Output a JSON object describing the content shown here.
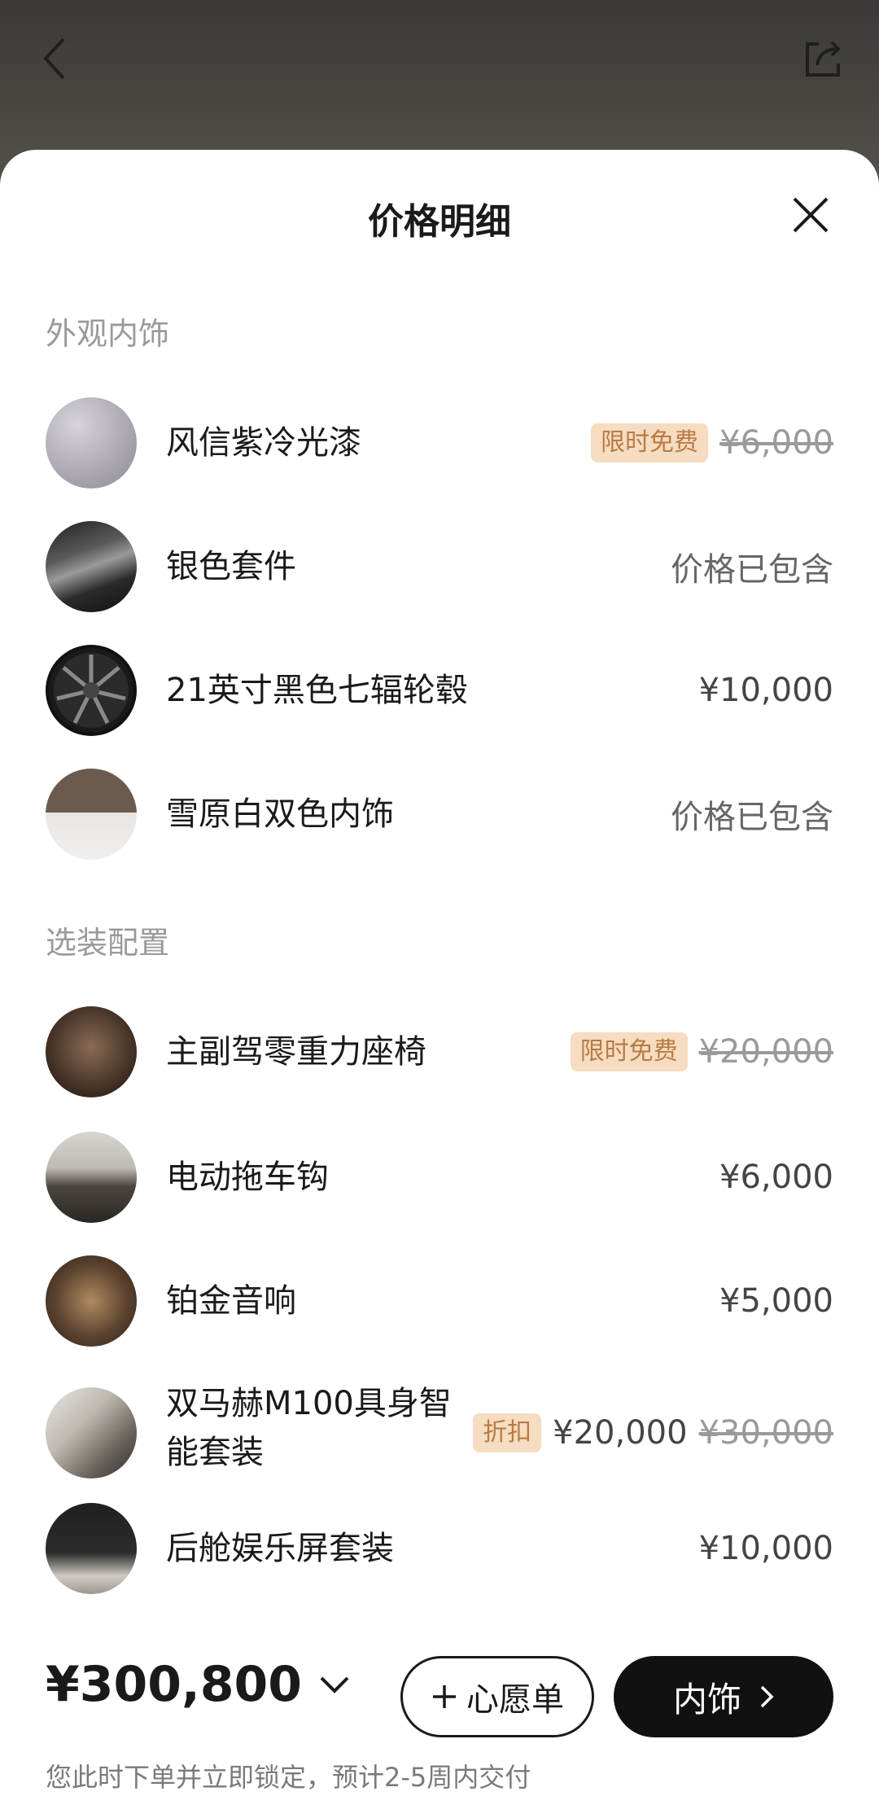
{
  "sheet": {
    "title": "价格明细"
  },
  "sections": {
    "exterior_title": "外观内饰",
    "options_title": "选装配置"
  },
  "exterior_items": [
    {
      "label": "风信紫冷光漆",
      "badge": "限时免费",
      "original_price": "¥6,000"
    },
    {
      "label": "银色套件",
      "price": "价格已包含"
    },
    {
      "label": "21英寸黑色七辐轮毂",
      "price": "¥10,000"
    },
    {
      "label": "雪原白双色内饰",
      "price": "价格已包含"
    }
  ],
  "option_items": [
    {
      "label": "主副驾零重力座椅",
      "badge": "限时免费",
      "original_price": "¥20,000"
    },
    {
      "label": "电动拖车钩",
      "price": "¥6,000"
    },
    {
      "label": "铂金音响",
      "price": "¥5,000"
    },
    {
      "label_line1": "双马赫M100具身智",
      "label_line2": "能套装",
      "badge": "折扣",
      "price": "¥20,000",
      "original_price": "¥30,000"
    },
    {
      "label": "后舱娱乐屏套装",
      "price": "¥10,000"
    }
  ],
  "footer": {
    "total": "¥300,800",
    "wishlist_label": "心愿单",
    "next_label": "内饰",
    "note": "您此时下单并立即锁定，预计2-5周内交付"
  },
  "icons": {
    "back": "chevron-left-icon",
    "share": "share-icon",
    "close": "close-icon",
    "expand": "chevron-down-icon",
    "add": "plus-icon",
    "next": "chevron-right-icon"
  }
}
